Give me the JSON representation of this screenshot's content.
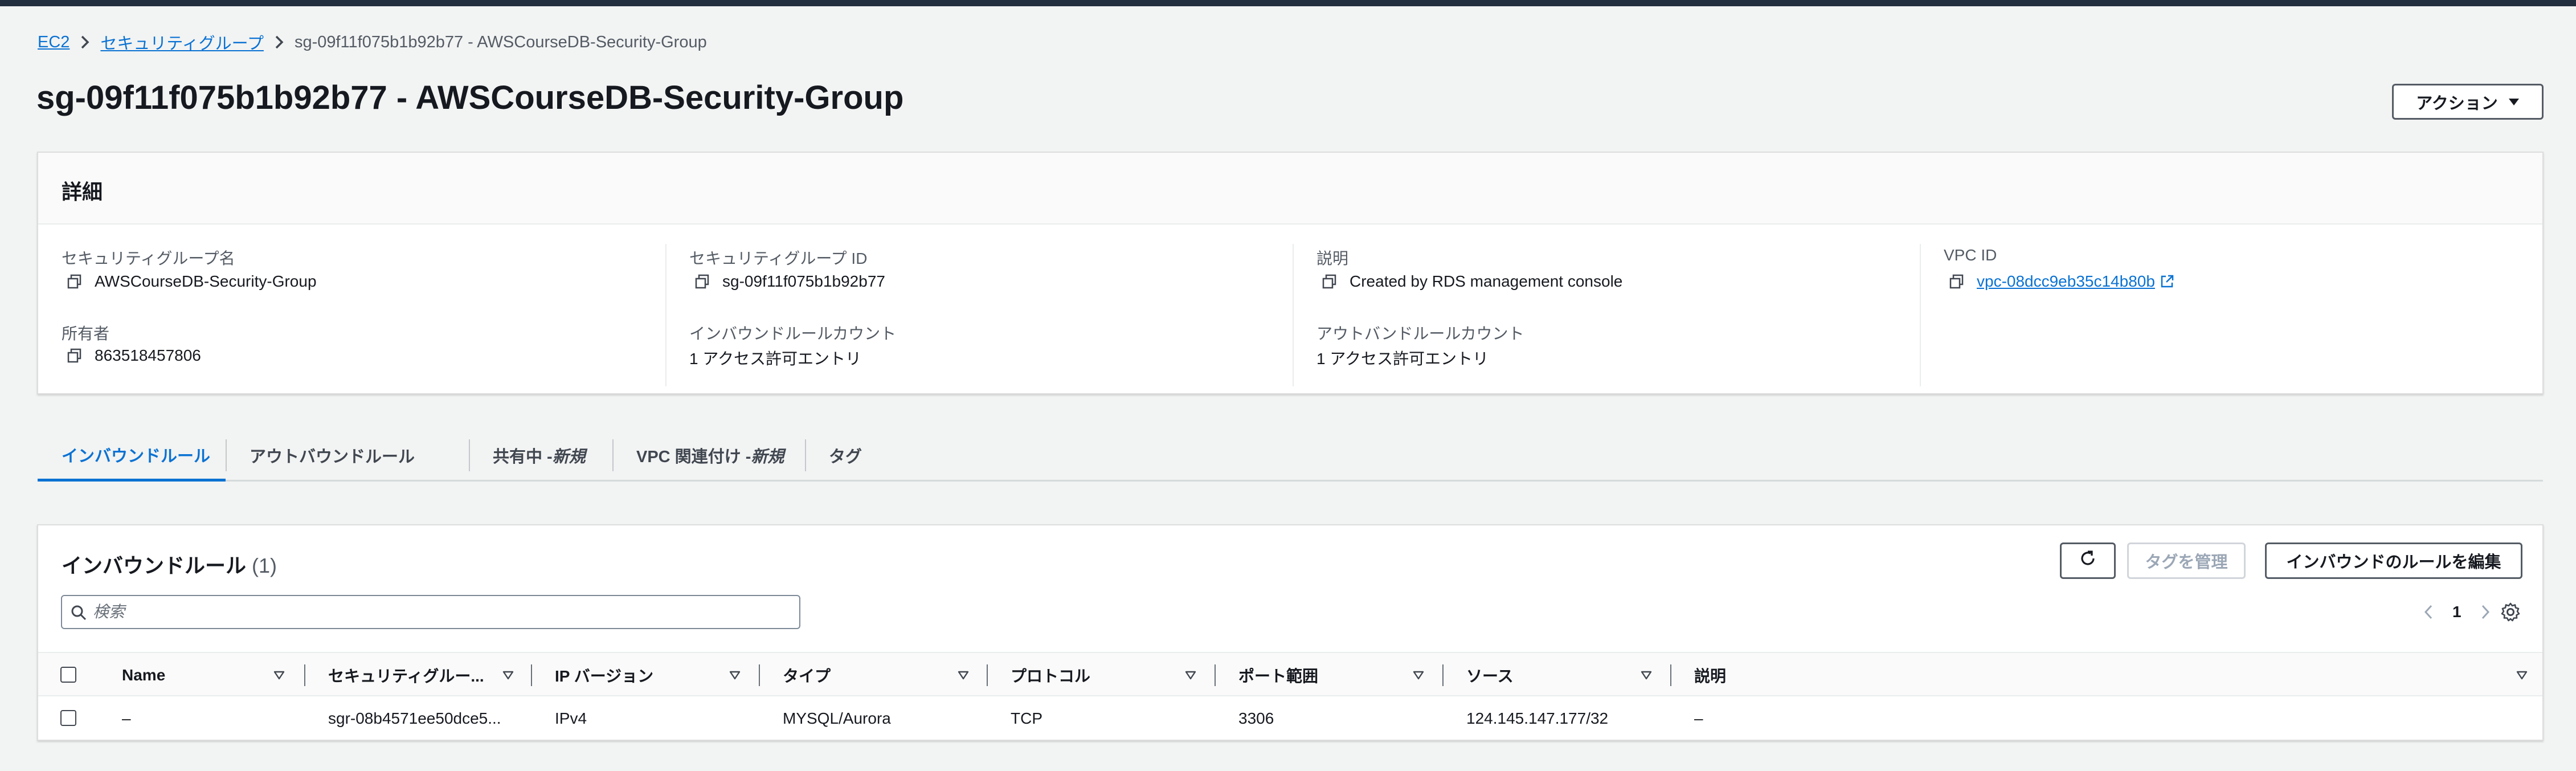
{
  "breadcrumb": {
    "items": [
      "EC2",
      "セキュリティグループ"
    ],
    "current": "sg-09f11f075b1b92b77 - AWSCourseDB-Security-Group"
  },
  "page_title": "sg-09f11f075b1b92b77 - AWSCourseDB-Security-Group",
  "actions_label": "アクション",
  "details": {
    "title": "詳細",
    "fields": [
      {
        "label": "セキュリティグループ名",
        "value": "AWSCourseDB-Security-Group"
      },
      {
        "label": "セキュリティグループ ID",
        "value": "sg-09f11f075b1b92b77"
      },
      {
        "label": "説明",
        "value": "Created by RDS management console"
      },
      {
        "label": "VPC ID",
        "value": "vpc-08dcc9eb35c14b80b"
      },
      {
        "label": "所有者",
        "value": "863518457806"
      },
      {
        "label": "インバウンドルールカウント",
        "value": "1 アクセス許可エントリ"
      },
      {
        "label": "アウトバンドルールカウント",
        "value": "1 アクセス許可エントリ"
      }
    ]
  },
  "tabs": [
    {
      "label": "インバウンドルール"
    },
    {
      "label": "アウトバウンドルール"
    },
    {
      "label": "共有中 - ",
      "tag": "新規"
    },
    {
      "label": "VPC 関連付け - ",
      "tag": "新規"
    },
    {
      "label": "タグ"
    }
  ],
  "inbound": {
    "title": "インバウンドルール",
    "count": "(1)",
    "manage_tags_label": "タグを管理",
    "edit_label": "インバウンドのルールを編集",
    "search_placeholder": "検索",
    "page_number": "1",
    "columns": [
      "Name",
      "セキュリティグルー...",
      "IP バージョン",
      "タイプ",
      "プロトコル",
      "ポート範囲",
      "ソース",
      "説明"
    ],
    "rows": [
      [
        "–",
        "sgr-08b4571ee50dce5...",
        "IPv4",
        "MYSQL/Aurora",
        "TCP",
        "3306",
        "124.145.147.177/32",
        "–"
      ]
    ]
  },
  "colors": {
    "accent": "#0972d3",
    "topbar": "#232f3e",
    "background": "#f2f3f3"
  }
}
